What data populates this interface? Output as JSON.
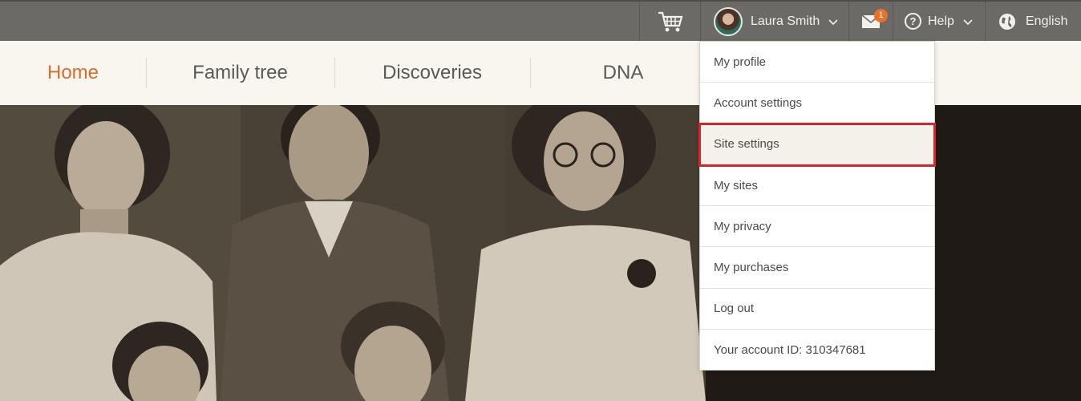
{
  "topbar": {
    "cart_icon": "shopping-cart-icon",
    "user_name": "Laura Smith",
    "messages_badge": "1",
    "help_label": "Help",
    "help_icon": "?",
    "language_label": "English"
  },
  "nav": {
    "items": [
      {
        "label": "Home",
        "active": true
      },
      {
        "label": "Family tree"
      },
      {
        "label": "Discoveries"
      },
      {
        "label": "DNA"
      }
    ]
  },
  "account_menu": {
    "items": [
      {
        "label": "My profile"
      },
      {
        "label": "Account settings"
      },
      {
        "label": "Site settings",
        "highlighted": true
      },
      {
        "label": "My sites"
      },
      {
        "label": "My privacy"
      },
      {
        "label": "My purchases"
      },
      {
        "label": "Log out"
      },
      {
        "label": "Your account ID: 310347681"
      }
    ]
  },
  "colors": {
    "topbar": "#6b6a66",
    "nav_bg": "#f8f6ef",
    "nav_active": "#d86b2e",
    "badge": "#e8722a",
    "highlight_border": "#d9242c"
  }
}
